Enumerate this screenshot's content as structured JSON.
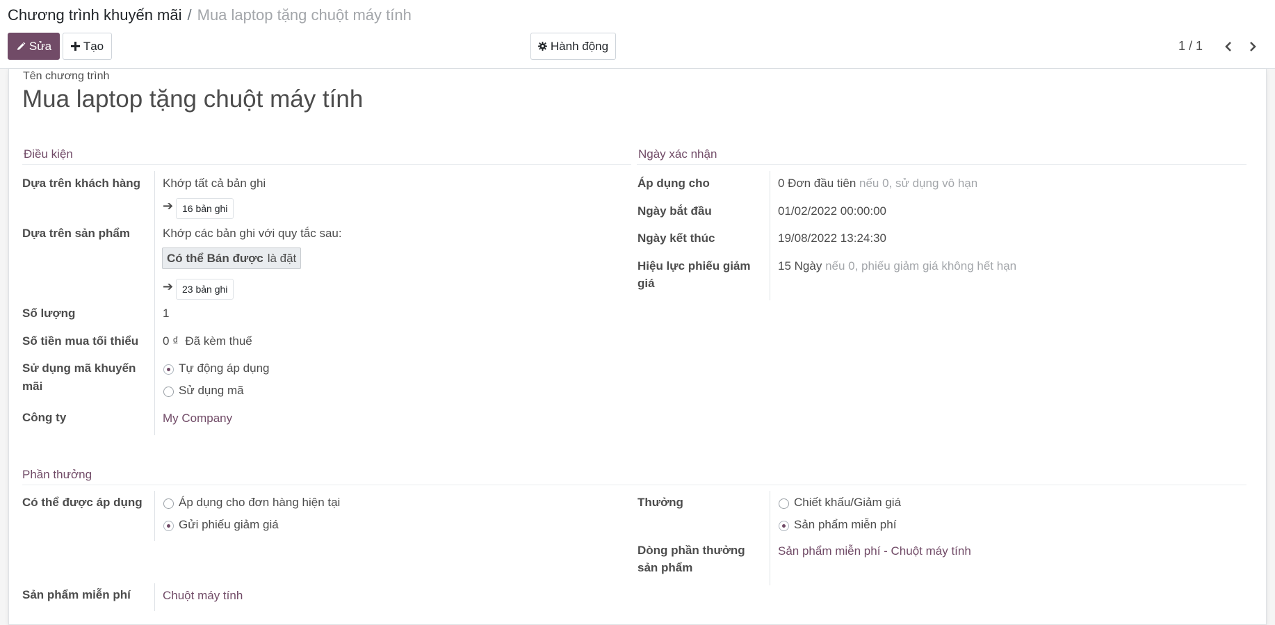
{
  "breadcrumb": {
    "parent": "Chương trình khuyến mãi",
    "separator": "/",
    "current": "Mua laptop tặng chuột máy tính"
  },
  "toolbar": {
    "edit_label": "Sửa",
    "create_label": "Tạo",
    "action_label": "Hành động"
  },
  "pager": {
    "value": "1 / 1"
  },
  "form": {
    "name_label": "Tên chương trình",
    "name_value": "Mua laptop tặng chuột máy tính",
    "conditions": {
      "title": "Điều kiện",
      "customer_label": "Dựa trên khách hàng",
      "customer_value": "Khớp tất cả bản ghi",
      "customer_records": "16 bản ghi",
      "product_label": "Dựa trên sản phẩm",
      "product_value": "Khớp các bản ghi với quy tắc sau:",
      "rule_field": "Có thể Bán được",
      "rule_op": "là đặt",
      "product_records": "23 bản ghi",
      "quantity_label": "Số lượng",
      "quantity_value": "1",
      "min_amount_label": "Số tiền mua tối thiểu",
      "min_amount_value": "0 ₫",
      "tax_value": "Đã kèm thuế",
      "code_label_1": "Sử dụng mã khuyến",
      "code_label_2": "mãi",
      "code_option_auto": "Tự động áp dụng",
      "code_option_code": "Sử dụng mã",
      "company_label": "Công ty",
      "company_value": "My Company"
    },
    "validity": {
      "title": "Ngày xác nhận",
      "apply_label": "Áp dụng cho",
      "apply_value": "0 Đơn đầu tiên",
      "apply_hint": "nếu 0, sử dụng vô hạn",
      "start_label": "Ngày bắt đầu",
      "start_value": "01/02/2022 00:00:00",
      "end_label": "Ngày kết thúc",
      "end_value": "19/08/2022 13:24:30",
      "coupon_label_1": "Hiệu lực phiếu giảm",
      "coupon_label_2": "giá",
      "coupon_value": "15 Ngày",
      "coupon_hint": "nếu 0, phiếu giảm giá không hết hạn"
    },
    "rewards": {
      "title": "Phần thưởng",
      "applicable_label": "Có thể được áp dụng",
      "applicable_option_current": "Áp dụng cho đơn hàng hiện tại",
      "applicable_option_coupon": "Gửi phiếu giảm giá",
      "reward_label": "Thưởng",
      "reward_option_discount": "Chiết khấu/Giảm giá",
      "reward_option_free": "Sản phẩm miễn phí",
      "reward_line_label_1": "Dòng phần thưởng",
      "reward_line_label_2": "sản phẩm",
      "reward_line_value": "Sản phẩm miễn phí - Chuột máy tính",
      "free_product_label": "Sản phẩm miễn phí",
      "free_product_value": "Chuột máy tính"
    }
  }
}
